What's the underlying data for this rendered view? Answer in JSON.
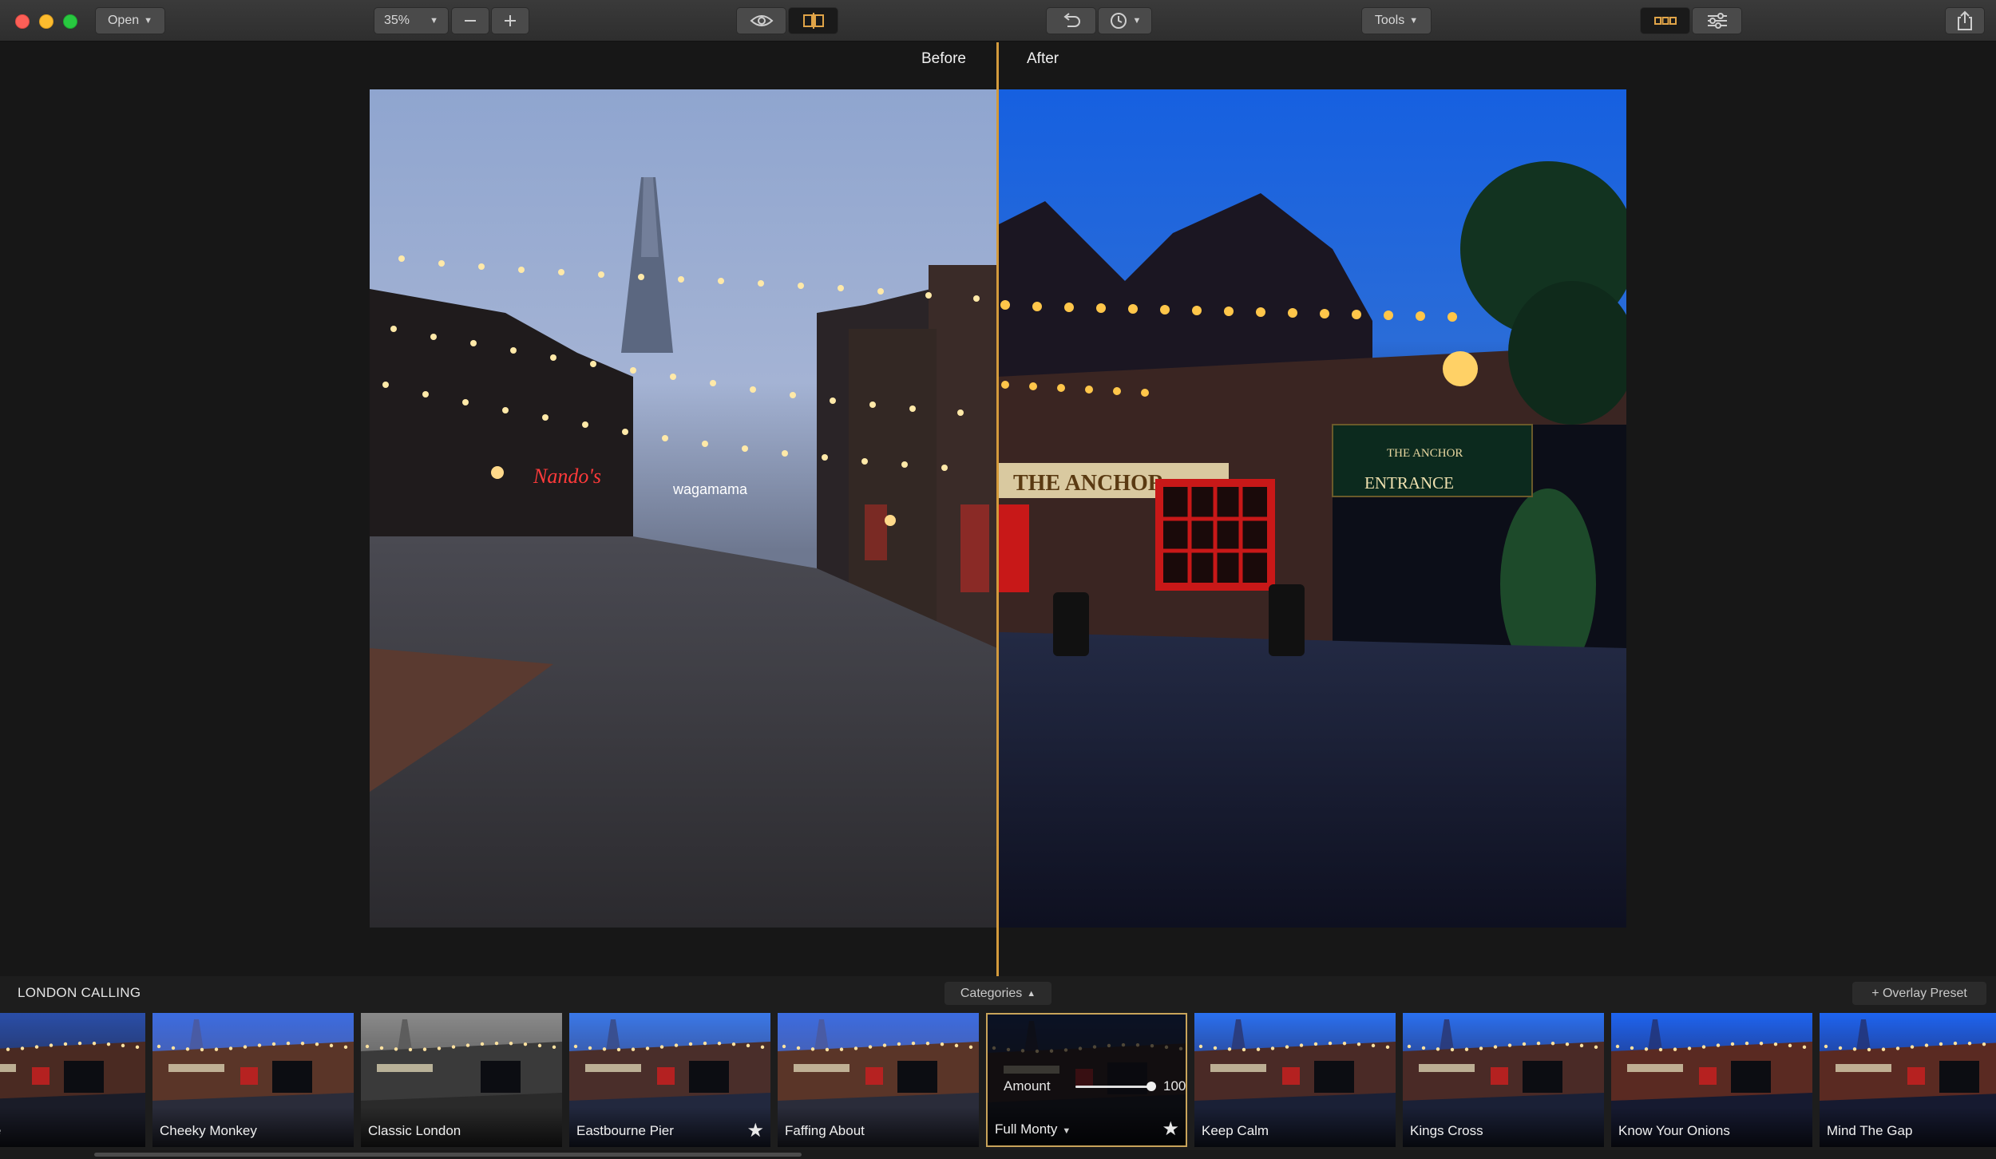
{
  "toolbar": {
    "open_label": "Open",
    "zoom_value": "35%",
    "tools_label": "Tools",
    "icons": {
      "zoom_out": "minus-icon",
      "zoom_in": "plus-icon",
      "preview": "eye-icon",
      "compare": "split-compare-icon",
      "undo": "undo-icon",
      "history": "clock-icon",
      "filmstrip_view": "presets-view-icon",
      "adjust_view": "sliders-icon",
      "share": "share-icon"
    }
  },
  "compare": {
    "before_label": "Before",
    "after_label": "After",
    "divider_color": "#d39a3c"
  },
  "filmstrip": {
    "collection_title": "LONDON CALLING",
    "categories_label": "Categories",
    "overlay_preset_label": "+ Overlay Preset",
    "presets": [
      {
        "name": "n Castle",
        "starred": false,
        "style": "warm"
      },
      {
        "name": "Cheeky Monkey",
        "starred": false,
        "style": "bright"
      },
      {
        "name": "Classic London",
        "starred": false,
        "style": "mono"
      },
      {
        "name": "Eastbourne Pier",
        "starred": true,
        "style": "cool"
      },
      {
        "name": "Faffing About",
        "starred": false,
        "style": "bright"
      },
      {
        "name": "Full Monty",
        "starred": true,
        "style": "dark",
        "selected": true,
        "amount_label": "Amount",
        "amount_value": 100
      },
      {
        "name": "Keep Calm",
        "starred": false,
        "style": "blue"
      },
      {
        "name": "Kings Cross",
        "starred": false,
        "style": "blue"
      },
      {
        "name": "Know Your Onions",
        "starred": false,
        "style": "vivid"
      },
      {
        "name": "Mind The Gap",
        "starred": false,
        "style": "vivid"
      }
    ],
    "star_glyph": "★"
  }
}
